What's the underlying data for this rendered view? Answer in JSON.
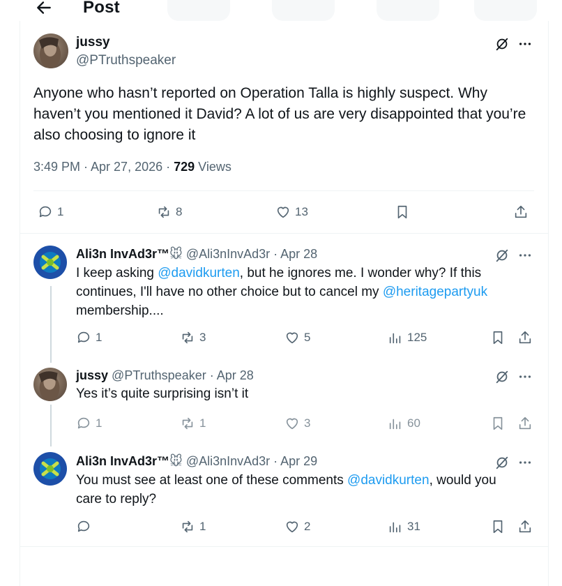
{
  "header": {
    "title": "Post"
  },
  "main_post": {
    "name": "jussy",
    "handle": "@PTruthspeaker",
    "text": "Anyone who hasn’t reported on Operation Talla is highly suspect. Why haven’t you mentioned it David? A lot of us are very disappointed that you’re also choosing to ignore it",
    "timestamp": "3:49 PM · Apr 27, 2026 · ",
    "views_count": "729",
    "views_label": " Views",
    "replies": "1",
    "reposts": "8",
    "likes": "13"
  },
  "replies": [
    {
      "name": "Ali3n InvAd3r™",
      "emoji": "🐭",
      "handle": "@Ali3nInvAd3r · Apr 28",
      "text_before": "I keep asking ",
      "mention1": "@davidkurten",
      "text_mid": ", but he ignores me. I wonder why? If this continues, I'll have no other choice but to cancel my ",
      "mention2": "@heritagepartyuk",
      "text_after": " membership....",
      "replies": "1",
      "reposts": "3",
      "likes": "5",
      "views": "125"
    },
    {
      "name": "jussy",
      "handle": "@PTruthspeaker · Apr 28",
      "text": "Yes it’s quite surprising isn’t it",
      "replies": "1",
      "reposts": "1",
      "likes": "3",
      "views": "60"
    },
    {
      "name": "Ali3n InvAd3r™",
      "emoji": "🐭",
      "handle": "@Ali3nInvAd3r · Apr 29",
      "text_before": "You must see at least one of these comments ",
      "mention1": "@davidkurten",
      "text_after": ", would you care to reply?",
      "replies": "",
      "reposts": "1",
      "likes": "2",
      "views": "31"
    }
  ],
  "colors": {
    "accent": "#1d9bf0",
    "muted": "#536471",
    "text": "#0f1419",
    "divider": "#eff3f4"
  },
  "icons": [
    "back-arrow-icon",
    "grok-icon",
    "more-icon",
    "reply-icon",
    "repost-icon",
    "like-icon",
    "views-icon",
    "bookmark-icon",
    "share-icon"
  ]
}
